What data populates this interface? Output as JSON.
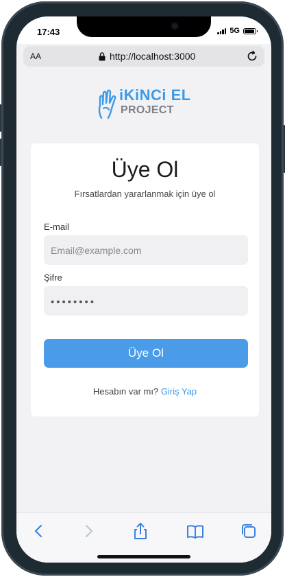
{
  "status_bar": {
    "time": "17:43",
    "network": "5G"
  },
  "browser": {
    "aa_label": "AA",
    "url": "http://localhost:3000"
  },
  "logo": {
    "line1": "iKiNCi EL",
    "line2": "PROJECT"
  },
  "signup": {
    "title": "Üye Ol",
    "subtitle": "Fırsatlardan yararlanmak için üye ol",
    "email_label": "E-mail",
    "email_placeholder": "Email@example.com",
    "email_value": "",
    "password_label": "Şifre",
    "password_value_masked": "••••••••",
    "submit_label": "Üye Ol",
    "footer_text": "Hesabın var mı?",
    "footer_link": "Giriş Yap"
  },
  "colors": {
    "accent": "#4a9be8",
    "link": "#3b9ae8",
    "background": "#f2f2f4"
  },
  "toolbar_icons": [
    "back-icon",
    "forward-icon",
    "share-icon",
    "bookmarks-icon",
    "tabs-icon"
  ]
}
